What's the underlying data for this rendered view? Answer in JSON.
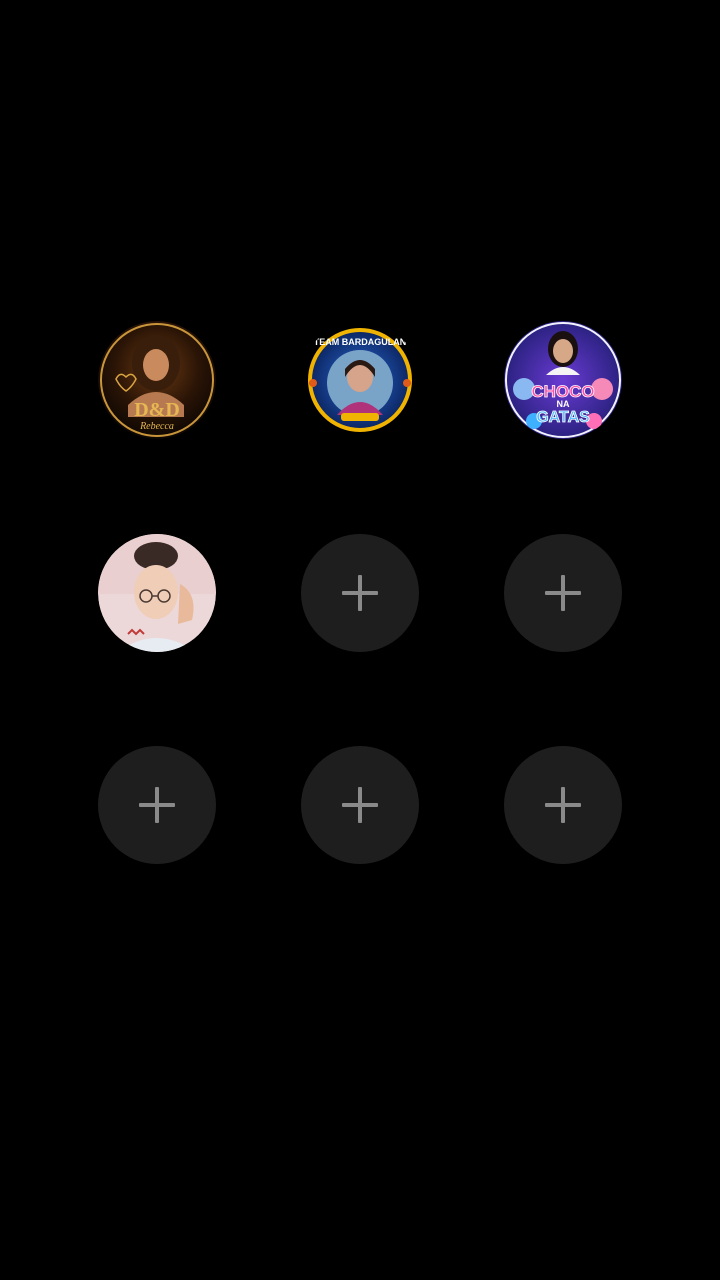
{
  "contacts": [
    {
      "id": "slot-1",
      "type": "avatar",
      "image_text_top": "D&D",
      "image_text_bottom": "Rebecca",
      "colors": {
        "bg": "#1a0d05",
        "accent": "#d9a441"
      }
    },
    {
      "id": "slot-2",
      "type": "avatar",
      "image_text_top": "TEAM BARDAGULAN",
      "image_text_bottom": "",
      "colors": {
        "bg": "#0b2f7a",
        "accent": "#f0b400"
      }
    },
    {
      "id": "slot-3",
      "type": "avatar",
      "image_text_top": "CHOCO",
      "image_text_middle": "NA",
      "image_text_bottom": "GATAS",
      "colors": {
        "bg": "#2a2c8f",
        "accent": "#ff5ab8"
      }
    },
    {
      "id": "slot-4",
      "type": "avatar",
      "colors": {
        "bg": "#e9d6d8",
        "accent": "#c9a9a6"
      }
    },
    {
      "id": "slot-5",
      "type": "add",
      "icon": "plus-icon"
    },
    {
      "id": "slot-6",
      "type": "add",
      "icon": "plus-icon"
    },
    {
      "id": "slot-7",
      "type": "add",
      "icon": "plus-icon"
    },
    {
      "id": "slot-8",
      "type": "add",
      "icon": "plus-icon"
    },
    {
      "id": "slot-9",
      "type": "add",
      "icon": "plus-icon"
    }
  ],
  "theme": {
    "background": "#000000",
    "empty_slot": "#1e1e1e",
    "plus_color": "#8a8a8a"
  }
}
